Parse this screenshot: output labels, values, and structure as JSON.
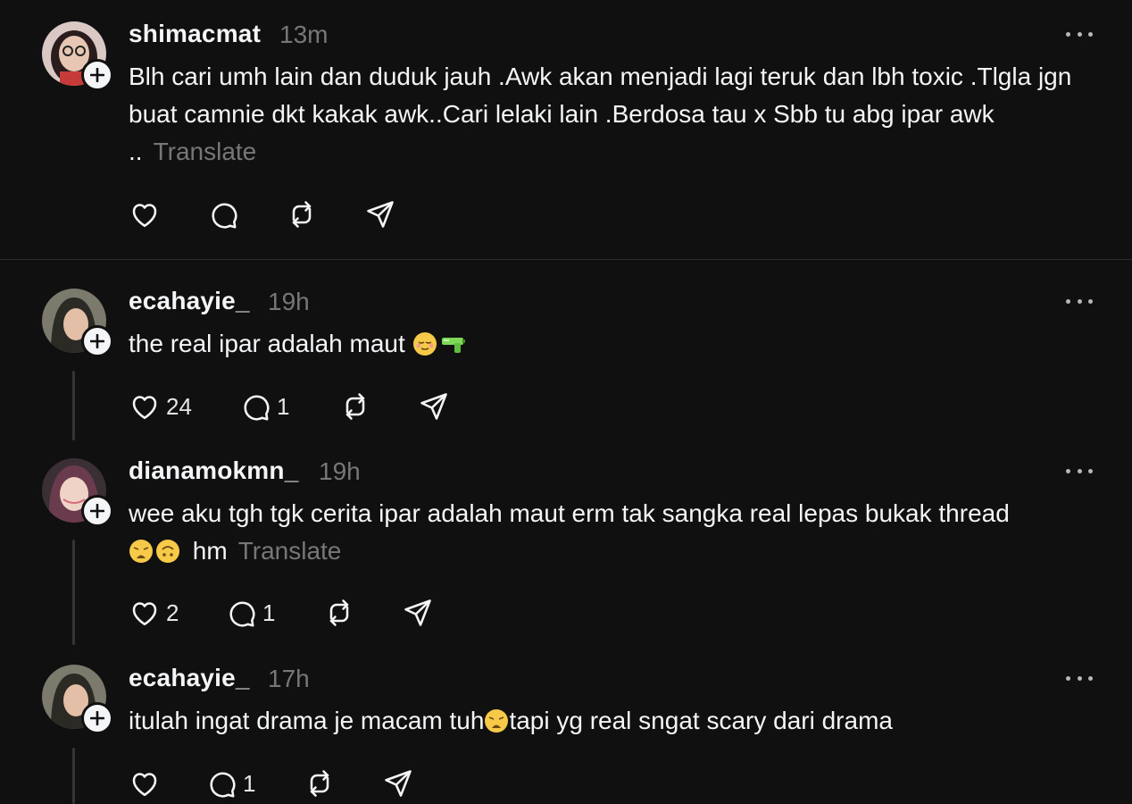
{
  "posts": [
    {
      "username": "shimacmat",
      "time": "13m",
      "text": "Blh cari umh lain dan duduk jauh .Awk akan menjadi lagi teruk dan lbh toxic .Tlgla jgn buat camnie dkt kakak awk..Cari lelaki lain .Berdosa tau x Sbb tu abg ipar awk ..",
      "translate": "Translate",
      "likes": "",
      "replies": ""
    },
    {
      "username": "ecahayie_",
      "time": "19h",
      "text": "the real ipar adalah maut",
      "translate": "",
      "likes": "24",
      "replies": "1"
    },
    {
      "username": "dianamokmn_",
      "time": "19h",
      "text_line1": "wee aku tgh tgk cerita ipar adalah maut erm tak sangka real lepas bukak thread",
      "text_line2": "hm",
      "translate": "Translate",
      "likes": "2",
      "replies": "1"
    },
    {
      "username": "ecahayie_",
      "time": "17h",
      "text_a": "itulah ingat drama je macam tuh",
      "text_b": "tapi yg real sngat scary dari drama",
      "translate": "",
      "likes": "",
      "replies": "1"
    }
  ],
  "icons": {
    "like": "heart-icon",
    "reply": "comment-icon",
    "repost": "repost-icon",
    "share": "send-icon",
    "more": "more-options-icon",
    "follow": "plus-icon"
  },
  "colors": {
    "background": "#101010",
    "text": "#f3f5f7",
    "muted": "#777777",
    "thread_line": "#333638"
  }
}
